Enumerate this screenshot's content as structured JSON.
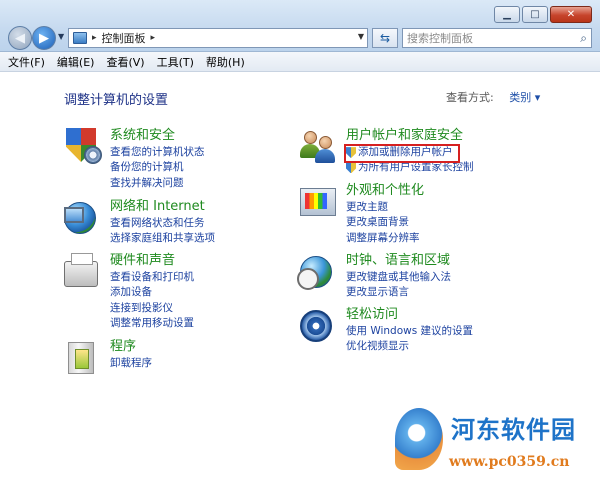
{
  "window": {
    "minimize_glyph": "▁",
    "maximize_glyph": "□",
    "close_glyph": "✕"
  },
  "address": {
    "path": "控制面板",
    "separator": "▸"
  },
  "search": {
    "placeholder": "搜索控制面板"
  },
  "menu": {
    "items": [
      {
        "label": "文件(F)"
      },
      {
        "label": "编辑(E)"
      },
      {
        "label": "查看(V)"
      },
      {
        "label": "工具(T)"
      },
      {
        "label": "帮助(H)"
      }
    ]
  },
  "page": {
    "title": "调整计算机的设置",
    "view_by_label": "查看方式:",
    "view_by_value": "类别 ▾"
  },
  "categories": {
    "system": {
      "title": "系统和安全",
      "links": [
        "查看您的计算机状态",
        "备份您的计算机",
        "查找并解决问题"
      ]
    },
    "network": {
      "title": "网络和 Internet",
      "links": [
        "查看网络状态和任务",
        "选择家庭组和共享选项"
      ]
    },
    "hardware": {
      "title": "硬件和声音",
      "links": [
        "查看设备和打印机",
        "添加设备",
        "连接到投影仪",
        "调整常用移动设置"
      ]
    },
    "programs": {
      "title": "程序",
      "links": [
        "卸载程序"
      ]
    },
    "users": {
      "title": "用户帐户和家庭安全",
      "links": [
        "添加或删除用户帐户",
        "为所有用户设置家长控制"
      ]
    },
    "appearance": {
      "title": "外观和个性化",
      "links": [
        "更改主题",
        "更改桌面背景",
        "调整屏幕分辨率"
      ]
    },
    "clock": {
      "title": "时钟、语言和区域",
      "links": [
        "更改键盘或其他输入法",
        "更改显示语言"
      ]
    },
    "ease": {
      "title": "轻松访问",
      "links": [
        "使用 Windows 建议的设置",
        "优化视频显示"
      ]
    }
  },
  "watermark": {
    "name": "河东软件园",
    "url": "www.pc0359.cn"
  },
  "colors": {
    "category_title": "#1f8a1f",
    "link": "#1e43a0",
    "highlight": "#d62020"
  }
}
